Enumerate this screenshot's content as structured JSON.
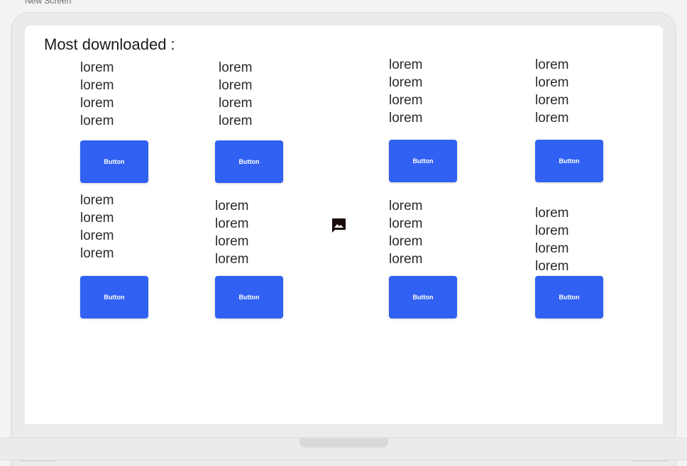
{
  "window": {
    "screen_label": "New Screen"
  },
  "main": {
    "title": "Most downloaded :",
    "items": [
      {
        "lines": [
          "lorem",
          "lorem",
          "lorem",
          "lorem"
        ],
        "button_label": "Button"
      },
      {
        "lines": [
          "lorem",
          "lorem",
          "lorem",
          "lorem"
        ],
        "button_label": "Button"
      },
      {
        "lines": [
          "lorem",
          "lorem",
          "lorem",
          "lorem"
        ],
        "button_label": "Button"
      },
      {
        "lines": [
          "lorem",
          "lorem",
          "lorem",
          "lorem"
        ],
        "button_label": "Button"
      },
      {
        "lines": [
          "lorem",
          "lorem",
          "lorem",
          "lorem"
        ],
        "button_label": "Button"
      },
      {
        "lines": [
          "lorem",
          "lorem",
          "lorem",
          "lorem"
        ],
        "button_label": "Button"
      },
      {
        "lines": [
          "lorem",
          "lorem",
          "lorem",
          "lorem"
        ],
        "button_label": "Button"
      },
      {
        "lines": [
          "lorem",
          "lorem",
          "lorem",
          "lorem"
        ],
        "button_label": "Button"
      }
    ],
    "center_icon": "image-message-icon"
  },
  "colors": {
    "button": "#3161f2",
    "button_text": "#ffffff"
  }
}
